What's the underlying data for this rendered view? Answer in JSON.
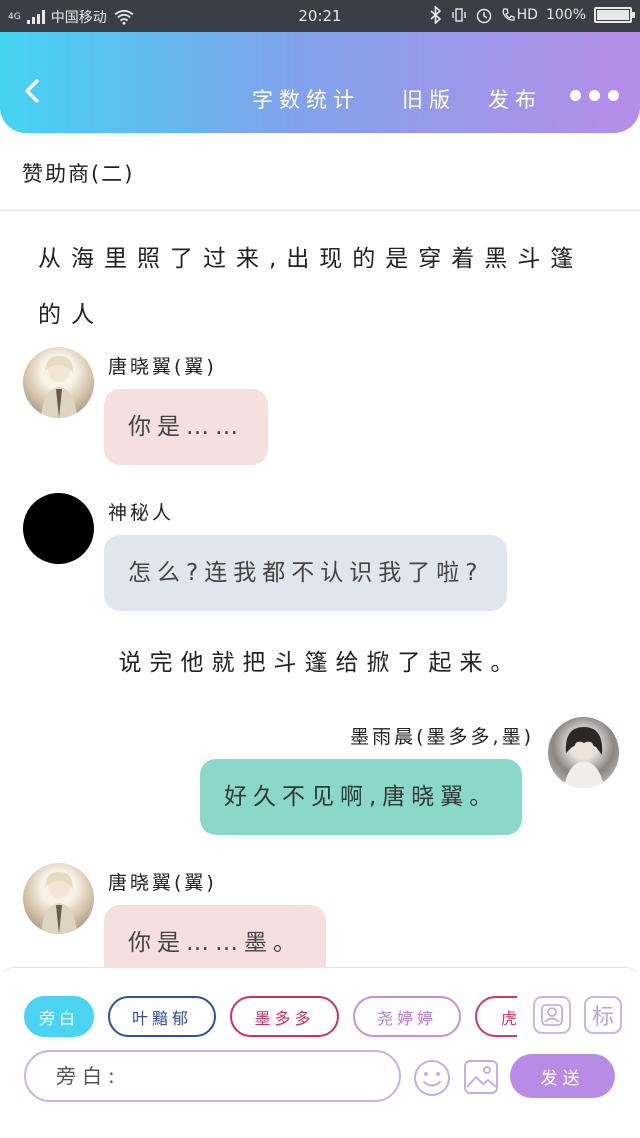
{
  "status_bar": {
    "network": "4G",
    "carrier": "中国移动",
    "time": "20:21",
    "hd": "HD",
    "battery": "100%",
    "battery_level": 1.0
  },
  "header": {
    "back_icon": "chevron-left-icon",
    "links": [
      "字数统计",
      "旧版",
      "发布"
    ],
    "more_icon": "more-dots-icon"
  },
  "chapter": {
    "title": "赞助商(二)"
  },
  "story": {
    "narration_top": "从海里照了过来,出现的是穿着黑斗篷的人",
    "messages": [
      {
        "speaker": "唐晓翼(翼)",
        "text": "你是……"
      },
      {
        "speaker": "神秘人",
        "text": "怎么?连我都不认识我了啦?"
      },
      {
        "speaker": "墨雨晨(墨多多,墨)",
        "text": "好久不见啊,唐晓翼。"
      },
      {
        "speaker": "唐晓翼(翼)",
        "text": "你是……墨。"
      }
    ],
    "narration_mid": "说完他就把斗篷给掀了起来。"
  },
  "composer": {
    "roles": [
      "旁白",
      "叶黯郁",
      "墨多多",
      "尧婷婷",
      "虎"
    ],
    "input_placeholder": "旁白:",
    "send_label": "发送",
    "tag_label": "标",
    "icons": [
      "role-avatar-icon",
      "tag-icon",
      "emoji-icon",
      "image-icon"
    ]
  },
  "colors": {
    "header_gradient": [
      "#44d4f3",
      "#b68de8"
    ],
    "bubble_pink": "#f6dfdf",
    "bubble_blue": "#dfe6ee",
    "bubble_teal": "#8ad8c9",
    "send_button": "#b88ce6"
  }
}
